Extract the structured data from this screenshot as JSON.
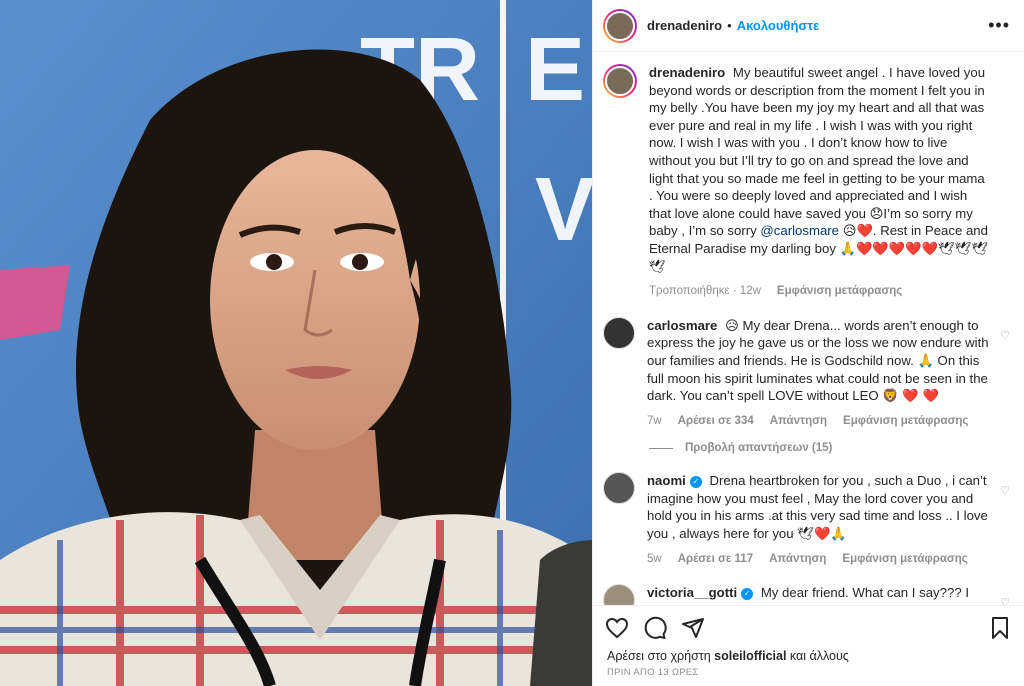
{
  "post": {
    "author": "drenadeniro",
    "follow_label": "Ακολουθήστε",
    "more_label": "•••",
    "photo_sign_letters": "TR E T V",
    "caption": {
      "user": "drenadeniro",
      "text_1": "My beautiful sweet angel . I have loved you beyond words or description from the moment I felt you in my belly .You have been my joy my heart and all that was ever pure and real in my life . I wish I was with you right now. I wish I was with you . I don’t know how to live without you but I’ll try to go on and spread the love and light that you so made me feel in getting to be your mama . You were so deeply loved and appreciated and I wish that love alone could have saved you 😞I’m so sorry my baby , I’m so sorry",
      "mention": "@carlosmare",
      "text_2": "😥❤️. Rest in Peace and Eternal Paradise my darling boy 🙏❤️❤️❤️❤️❤️🕊🕊🕊🕊",
      "edited": "Τροποποιήθηκε · 12w",
      "translate": "Εμφάνιση μετάφρασης"
    },
    "comments": [
      {
        "user": "carlosmare",
        "verified": false,
        "text": "😥 My dear Drena... words aren’t enough to express the joy he gave us or the loss we now endure with our families and friends. He is Godschild now. 🙏 On this full moon his spirit luminates what could not be seen in the dark. You can’t spell LOVE without LEO 🦁 ❤️ ❤️",
        "age": "7w",
        "likes": "Αρέσει σε 334",
        "reply": "Απάντηση",
        "translate": "Εμφάνιση μετάφρασης",
        "view_replies": "Προβολή απαντήσεων (15)"
      },
      {
        "user": "naomi",
        "verified": true,
        "text": "Drena heartbroken for you , such a Duo , i can’t imagine how you must feel , May the lord cover you and hold you in his arms .at this very sad time and loss .. I love you , always here for you 🕊❤️🙏",
        "age": "5w",
        "likes": "Αρέσει σε 117",
        "reply": "Απάντηση",
        "translate": "Εμφάνιση μετάφρασης"
      },
      {
        "user": "victoria__gotti",
        "verified": true,
        "text": "My dear friend. What can I say??? I AM heartbroken! I have no words for my younger but ever SO"
      }
    ],
    "liked_by_prefix": "Αρέσει στο χρήστη",
    "liked_by_user": "soleilofficial",
    "liked_by_suffix": "και άλλους",
    "time_ago": "ΠΡΙΝ ΑΠΟ 13 ΩΡΕΣ",
    "icons": {
      "like": "heart-icon",
      "comment": "comment-icon",
      "share": "share-icon",
      "save": "bookmark-icon"
    }
  }
}
